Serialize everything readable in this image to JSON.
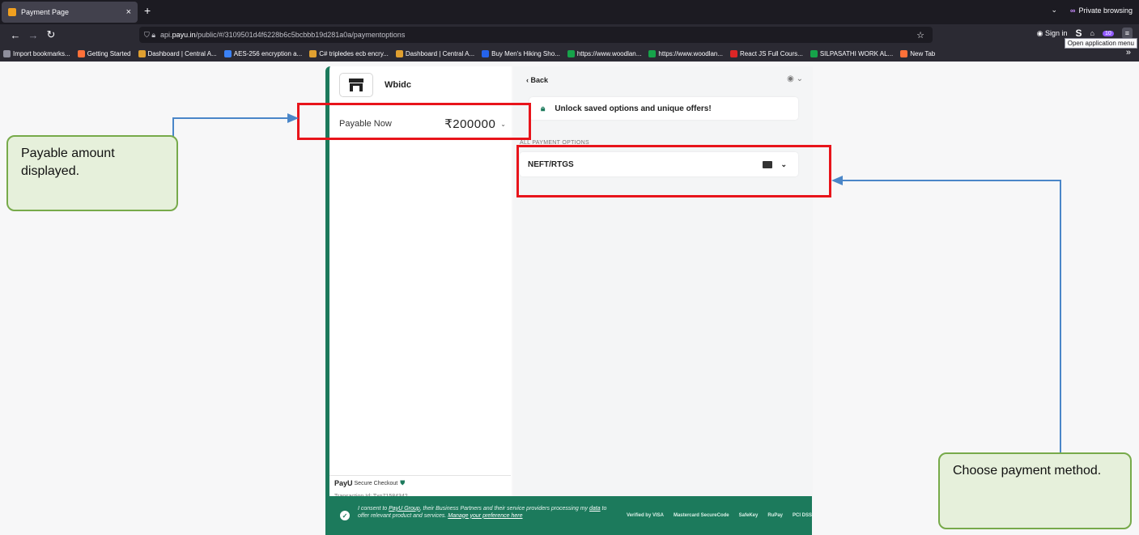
{
  "browser": {
    "tab_title": "Payment Page",
    "tab_close": "×",
    "new_tab": "+",
    "private_label": "Private browsing",
    "url_prefix": "api.",
    "url_host": "payu.in",
    "url_path": "/public/#/3109501d4f6228b6c5bcbbb19d281a0a/paymentoptions",
    "sign_in": "Sign in",
    "badge_count": "10",
    "tooltip": "Open application menu",
    "bookmarks": [
      {
        "label": "Import bookmarks...",
        "color": "#8f8f9d"
      },
      {
        "label": "Getting Started",
        "color": "#ff7139"
      },
      {
        "label": "Dashboard | Central A...",
        "color": "#e0a030"
      },
      {
        "label": "AES-256 encryption a...",
        "color": "#3b82f6"
      },
      {
        "label": "C# tripledes ecb encry...",
        "color": "#e0a030"
      },
      {
        "label": "Dashboard | Central A...",
        "color": "#e0a030"
      },
      {
        "label": "Buy Men's Hiking Sho...",
        "color": "#2563eb"
      },
      {
        "label": "https://www.woodlan...",
        "color": "#16a34a"
      },
      {
        "label": "https://www.woodlan...",
        "color": "#16a34a"
      },
      {
        "label": "React JS Full Cours...",
        "color": "#dc2626"
      },
      {
        "label": "SILPASATHI WORK AL...",
        "color": "#16a34a"
      },
      {
        "label": "New Tab",
        "color": "#ff7139"
      }
    ]
  },
  "payment": {
    "merchant": "Wbidc",
    "payable_label": "Payable Now",
    "amount": "₹200000",
    "back": "‹ Back",
    "unlock_text": "Unlock saved options and unique offers!",
    "all_options_label": "ALL PAYMENT OPTIONS",
    "option_label": "NEFT/RTGS",
    "payu_logo": "PayU",
    "secure_checkout": "Secure Checkout",
    "transaction_id": "Transaction Id: Txn71584342",
    "consent_prefix": "I consent to ",
    "consent_link1": "PayU Group",
    "consent_mid": ", their Business Partners and their service providers processing my ",
    "consent_link2": "data",
    "consent_mid2": " to offer relevant product and services. ",
    "consent_link3": "Manage your preference here",
    "cert_logos": [
      "Verified by VISA",
      "Mastercard SecureCode",
      "SafeKey",
      "RuPay",
      "PCI DSS"
    ]
  },
  "annotations": {
    "callout_left": "Payable amount displayed.",
    "callout_right": "Choose payment method.",
    "highlight_color": "#e8141b",
    "arrow_color": "#4a86c8"
  }
}
